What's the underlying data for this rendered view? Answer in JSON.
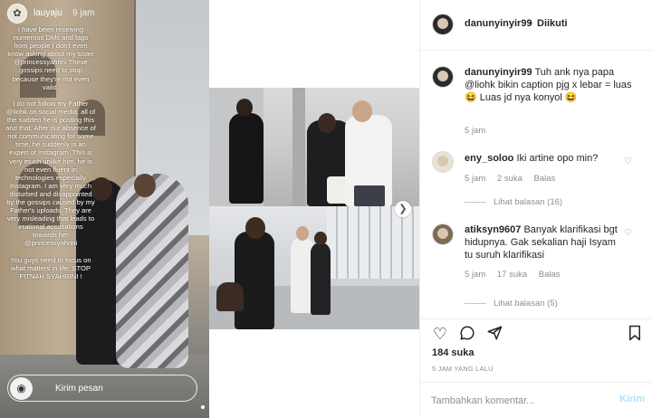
{
  "story": {
    "username": "lauyaju",
    "time": "9 jam",
    "text": "I have been receiving numerous DMs and tags from people I don't even know asking about my sister @princessyahrini These gossips need to stop because they're not even valid.\n\nI do not follow my Father @liohk on social media, all of the sudden he is posting this and that. After our absence of not communicating for some time, he suddenly is an expert of Instagram. This is very much unlike him, he is not even fluent in technologies especially Instagram. I am very much disturbed and disappointed by the gossips caused by my Father's uploads. They are very misleading that leads to irrational accusations towards her @princessyahrini\n\nYou guys need to focus on what matters in life. STOP FITNAH SYAHRINI !",
    "reply_placeholder": "Kirim pesan"
  },
  "post": {
    "username": "danunyinyir99",
    "follow_label": "Diikuti",
    "separator": "•"
  },
  "comments": [
    {
      "username": "danunyinyir99",
      "text": "Tuh ank nya papa @liohk bikin caption pjg x lebar = luas 😆 Luas jd nya konyol 😆",
      "time": "5 jam"
    },
    {
      "username": "eny_soloo",
      "text": "Iki artine opo min?",
      "time": "5 jam",
      "likes": "2 suka",
      "reply": "Balas",
      "view_replies": "Lihat balasan (16)"
    },
    {
      "username": "atiksyn9607",
      "text": "Banyak klarifikasi bgt hidupnya. Gak sekalian haji Isyam tu suruh klarifikasi",
      "time": "5 jam",
      "likes": "17 suka",
      "reply": "Balas",
      "view_replies": "Lihat balasan (5)"
    }
  ],
  "likes_count": "184 suka",
  "time_ago": "5 JAM YANG LALU",
  "add_comment": {
    "placeholder": "Tambahkan komentar...",
    "post_label": "Kirim"
  },
  "icons": {
    "like": "heart-icon",
    "comment": "comment-icon",
    "share": "share-icon",
    "save": "bookmark-icon",
    "camera": "camera-icon",
    "next": "chevron-right-icon"
  },
  "colors": {
    "post_button_disabled": "#b2dffc",
    "link": "#003569",
    "muted": "#8e8e8e"
  }
}
